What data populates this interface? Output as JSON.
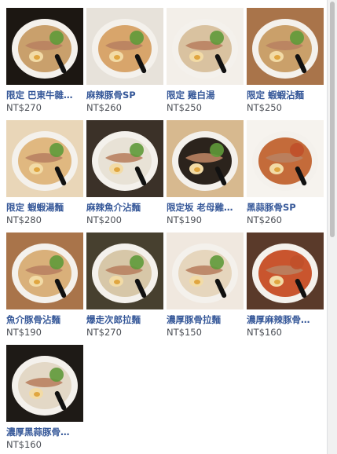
{
  "products": [
    {
      "name": "限定 巴東牛雜…",
      "price": "NT$270"
    },
    {
      "name": "麻辣豚骨SP",
      "price": "NT$260"
    },
    {
      "name": "限定 雞白湯",
      "price": "NT$250"
    },
    {
      "name": "限定 蝦蝦沾麵",
      "price": "NT$250"
    },
    {
      "name": "限定 蝦蝦湯麵",
      "price": "NT$280"
    },
    {
      "name": "麻辣魚介沾麵",
      "price": "NT$200"
    },
    {
      "name": "限定坂 老母雞…",
      "price": "NT$190"
    },
    {
      "name": "黑蒜豚骨SP",
      "price": "NT$260"
    },
    {
      "name": "魚介豚骨沾麵",
      "price": "NT$190"
    },
    {
      "name": "爆走次郎拉麵",
      "price": "NT$270"
    },
    {
      "name": "濃厚豚骨拉麵",
      "price": "NT$150"
    },
    {
      "name": "濃厚麻辣豚骨…",
      "price": "NT$160"
    },
    {
      "name": "濃厚黑蒜豚骨…",
      "price": "NT$160"
    }
  ],
  "thumb_colors": {
    "wood": "#a9744a",
    "dark": "#1c1712",
    "bowl": "#f4f1ec",
    "broth": "#d9b07a",
    "chashu": "#b98262",
    "egg": "#f2dba6",
    "scallion": "#5f9a3a",
    "spicy": "#c0502a",
    "link": "#365899",
    "price": "#4b4f56"
  }
}
